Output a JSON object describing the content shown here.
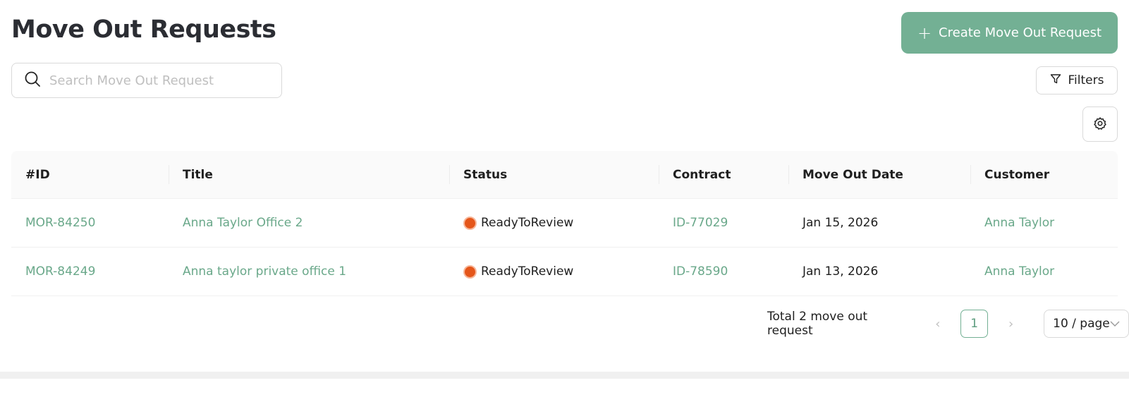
{
  "page": {
    "title": "Move Out Requests",
    "create_button_label": "Create Move Out Request"
  },
  "search": {
    "placeholder": "Search Move Out Request",
    "value": ""
  },
  "toolbar": {
    "filters_label": "Filters",
    "settings_icon": "gear-icon"
  },
  "table": {
    "columns": [
      "#ID",
      "Title",
      "Status",
      "Contract",
      "Move Out Date",
      "Customer"
    ],
    "rows": [
      {
        "id": "MOR-84250",
        "title": "Anna Taylor Office 2",
        "status": "ReadyToReview",
        "contract": "ID-77029",
        "move_out_date": "Jan 15, 2026",
        "customer": "Anna Taylor"
      },
      {
        "id": "MOR-84249",
        "title": "Anna taylor private office 1",
        "status": "ReadyToReview",
        "contract": "ID-78590",
        "move_out_date": "Jan 13, 2026",
        "customer": "Anna Taylor"
      }
    ]
  },
  "pagination": {
    "total_text": "Total 2 move out request",
    "current_page": "1",
    "page_size": "10 / page"
  },
  "colors": {
    "accent": "#73b094",
    "link": "#6aa88a",
    "status_ready": "#e5561a"
  }
}
